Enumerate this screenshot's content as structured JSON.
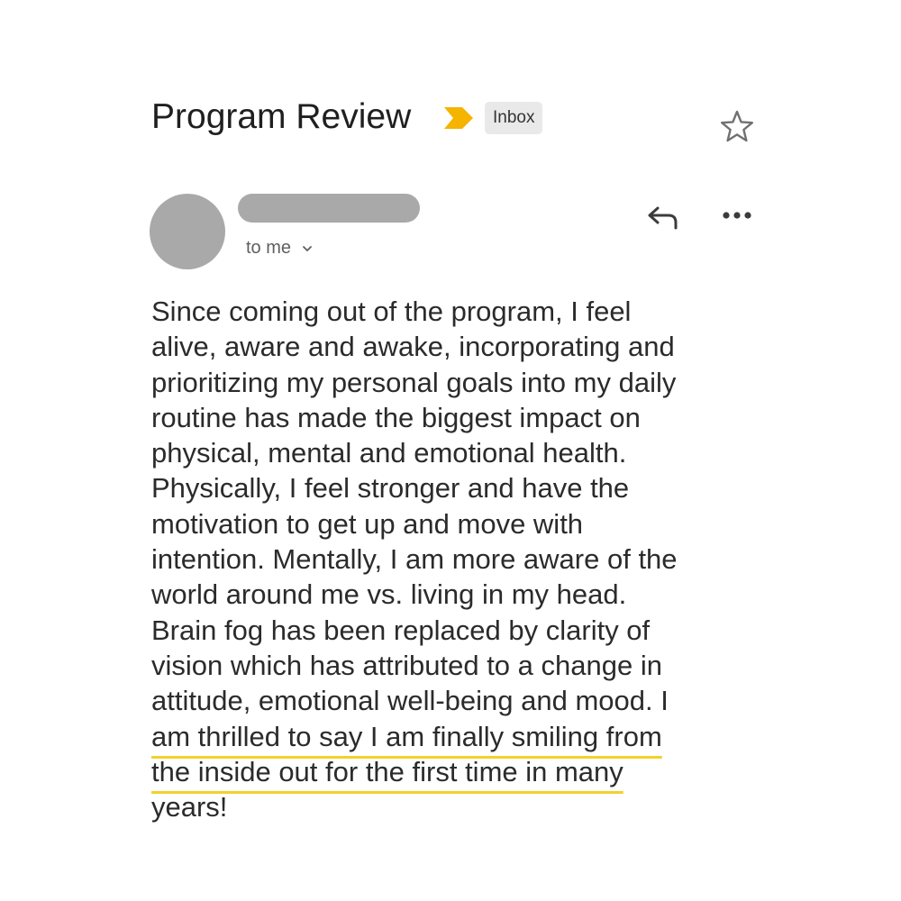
{
  "header": {
    "subject": "Program Review",
    "label": "Inbox",
    "importance_color": "#f4b400"
  },
  "sender": {
    "recipient_text": "to me"
  },
  "message": {
    "body_lines": [
      "Since coming out of the program, I feel",
      "alive, aware and awake, incorporating and",
      "prioritizing my personal goals into my daily",
      "routine has made the biggest impact on",
      "physical, mental and emotional health.",
      "Physically, I feel stronger and have the",
      "motivation to get up and move with",
      "intention. Mentally, I am more aware of the",
      "world around me vs. living in my head.",
      "Brain fog has been replaced by clarity of",
      "vision which has attributed to a change in",
      "attitude, emotional well-being and mood. I"
    ],
    "highlighted_lines": [
      "am thrilled to say I am finally smiling from",
      "the inside out for the first time in many"
    ],
    "last_line": "years!",
    "highlight_color": "#f2d22c"
  },
  "icons": {
    "star": "star-outline-icon",
    "reply": "reply-arrow-icon",
    "more": "more-horizontal-icon",
    "importance": "importance-marker-icon",
    "recipient_chevron": "chevron-down-icon"
  }
}
